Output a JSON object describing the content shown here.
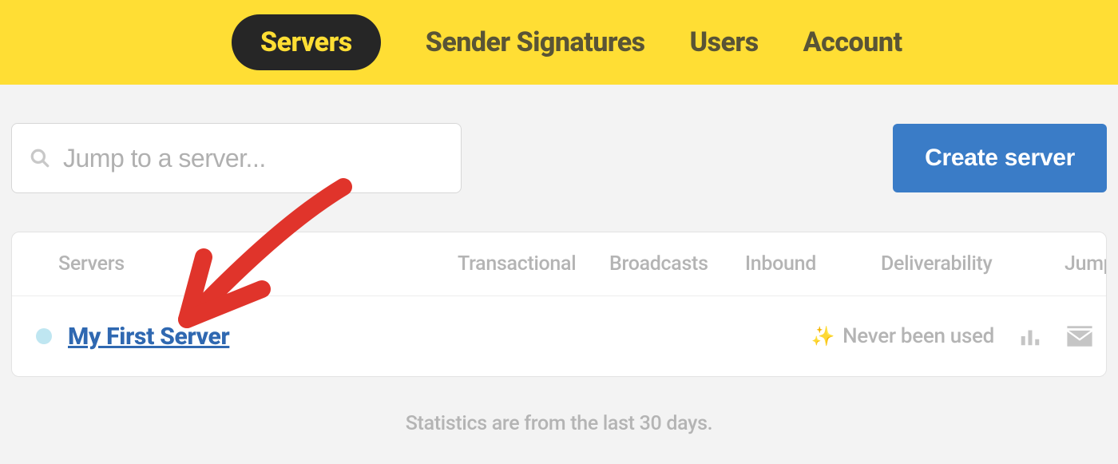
{
  "nav": {
    "items": [
      {
        "label": "Servers",
        "active": true
      },
      {
        "label": "Sender Signatures",
        "active": false
      },
      {
        "label": "Users",
        "active": false
      },
      {
        "label": "Account",
        "active": false
      }
    ]
  },
  "toolbar": {
    "search_placeholder": "Jump to a server...",
    "create_label": "Create server"
  },
  "table": {
    "headers": {
      "servers": "Servers",
      "transactional": "Transactional",
      "broadcasts": "Broadcasts",
      "inbound": "Inbound",
      "deliverability": "Deliverability",
      "jump": "Jump to..."
    },
    "rows": [
      {
        "name": "My First Server",
        "dot_color": "#bfe6f1",
        "status": "Never been used"
      }
    ]
  },
  "footer": "Statistics are from the last 30 days.",
  "colors": {
    "accent_yellow": "#ffde34",
    "nav_pill": "#262626",
    "primary_button": "#3a7cc7",
    "link": "#2f68b1",
    "annotation": "#e0342b"
  }
}
